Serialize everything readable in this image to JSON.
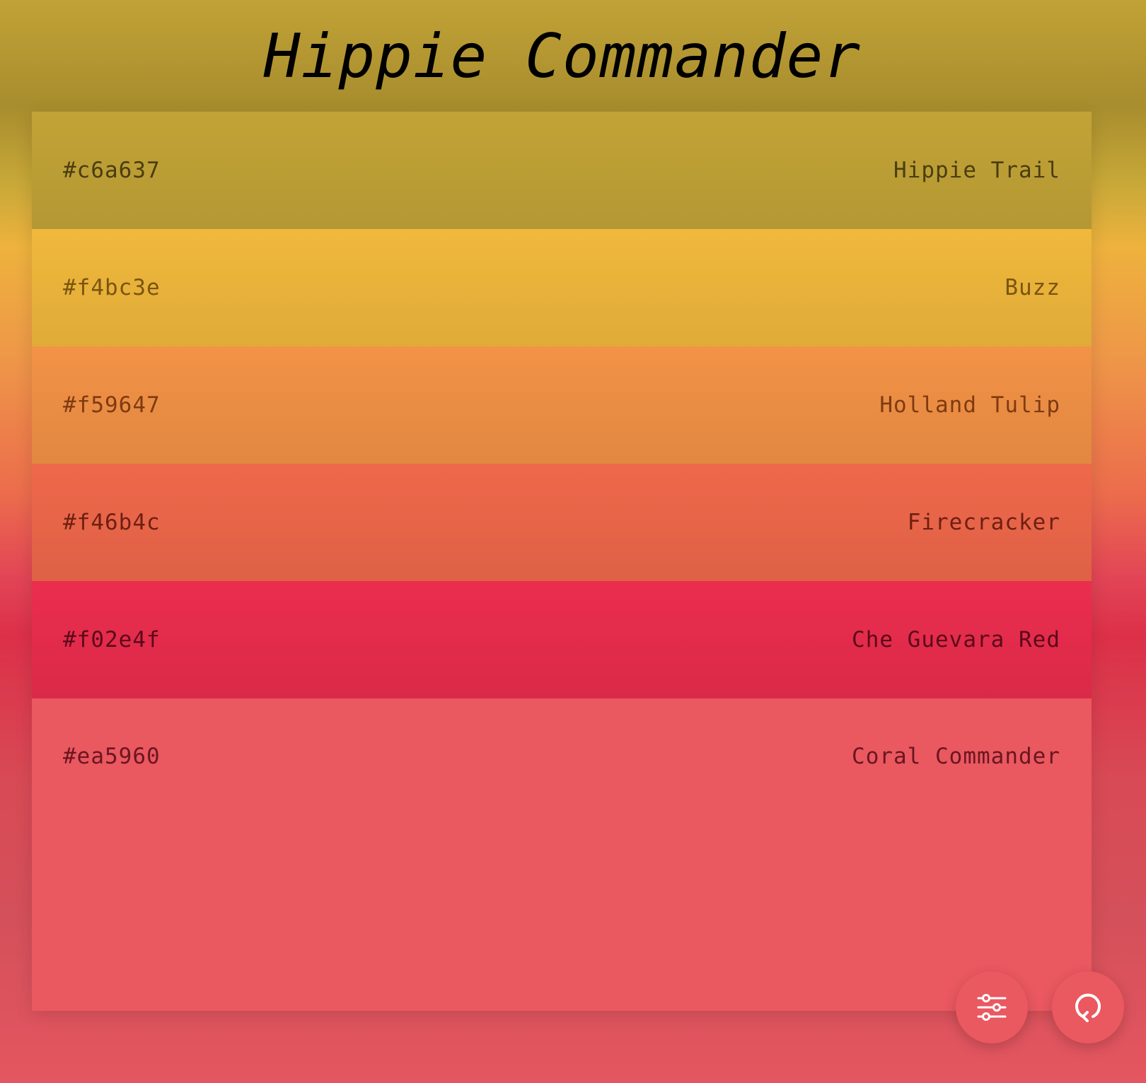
{
  "page": {
    "title": "Hippie Commander"
  },
  "swatches": [
    {
      "hex": "#c6a637",
      "name": "Hippie Trail",
      "bg": "#c2a337",
      "text": "#4a3d10"
    },
    {
      "hex": "#f4bc3e",
      "name": "Buzz",
      "bg": "#f0b83c",
      "text": "#7a5410"
    },
    {
      "hex": "#f59647",
      "name": "Holland Tulip",
      "bg": "#f29246",
      "text": "#7f3a10"
    },
    {
      "hex": "#f46b4c",
      "name": "Firecracker",
      "bg": "#ef684b",
      "text": "#6e1f12"
    },
    {
      "hex": "#f02e4f",
      "name": "Che Guevara Red",
      "bg": "#eb2d4e",
      "text": "#5c0a18"
    },
    {
      "hex": "#ea5960",
      "name": "Coral Commander",
      "bg": "#ea5860",
      "text": "#6a1620"
    }
  ],
  "buttons": {
    "settings": {
      "icon": "sliders-icon",
      "bg": "#ea5860"
    },
    "refresh": {
      "icon": "refresh-icon",
      "bg": "#ea5860"
    }
  }
}
